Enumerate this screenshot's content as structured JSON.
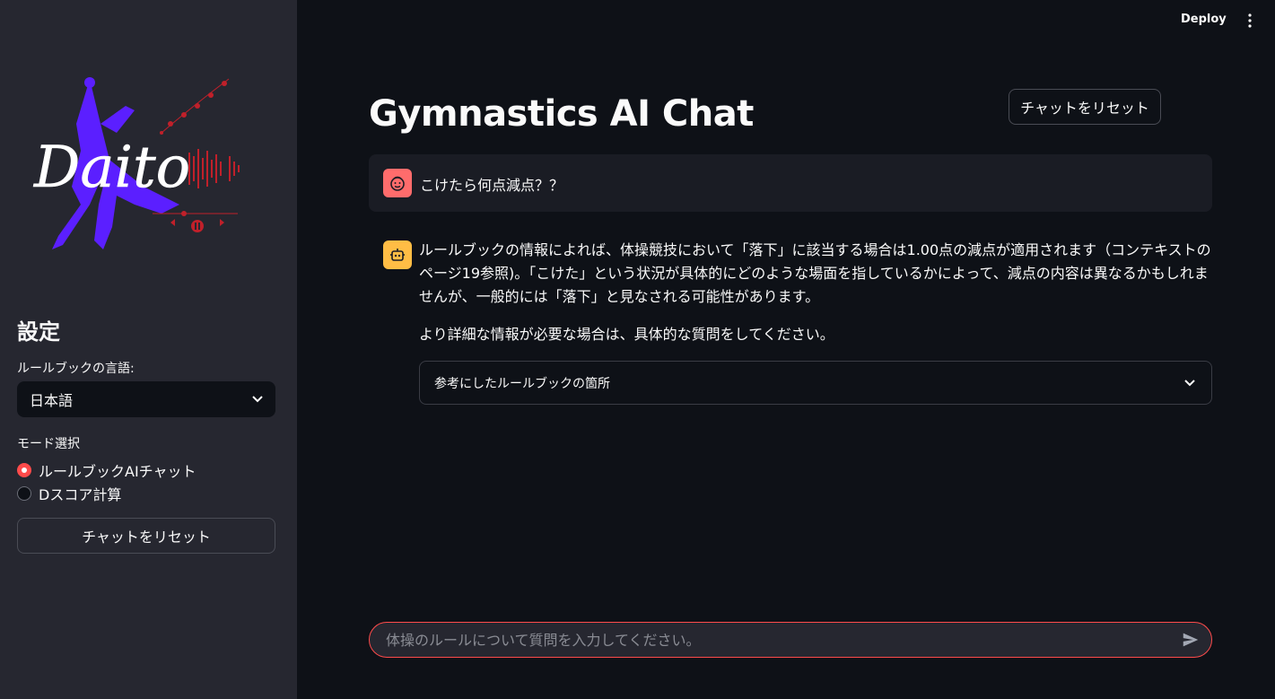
{
  "header": {
    "deploy_label": "Deploy",
    "menu_icon": "more-vertical-icon"
  },
  "sidebar": {
    "logo_text": "Daito",
    "settings_title": "設定",
    "language_label": "ルールブックの言語:",
    "language_value": "日本語",
    "mode_label": "モード選択",
    "mode_options": [
      {
        "label": "ルールブックAIチャット",
        "selected": true
      },
      {
        "label": "Dスコア計算",
        "selected": false
      }
    ],
    "reset_label": "チャットをリセット"
  },
  "main": {
    "title": "Gymnastics AI Chat",
    "reset_label": "チャットをリセット",
    "user_message": "こけたら何点減点？？",
    "bot_paragraphs": [
      "ルールブックの情報によれば、体操競技において「落下」に該当する場合は1.00点の減点が適用されます（コンテキストのページ19参照)。「こけた」という状況が具体的にどのような場面を指しているかによって、減点の内容は異なるかもしれませんが、一般的には「落下」と見なされる可能性があります。",
      "より詳細な情報が必要な場合は、具体的な質問をしてください。"
    ],
    "expander_label": "参考にしたルールブックの箇所",
    "input_placeholder": "体操のルールについて質問を入力してください。"
  },
  "colors": {
    "accent": "#ff4b4b",
    "sidebar_bg": "#262730",
    "main_bg": "#0e1117",
    "user_avatar": "#ff6c6c",
    "bot_avatar": "#ffbd45",
    "logo_purple": "#5b1fff",
    "logo_red": "#c0202a"
  }
}
